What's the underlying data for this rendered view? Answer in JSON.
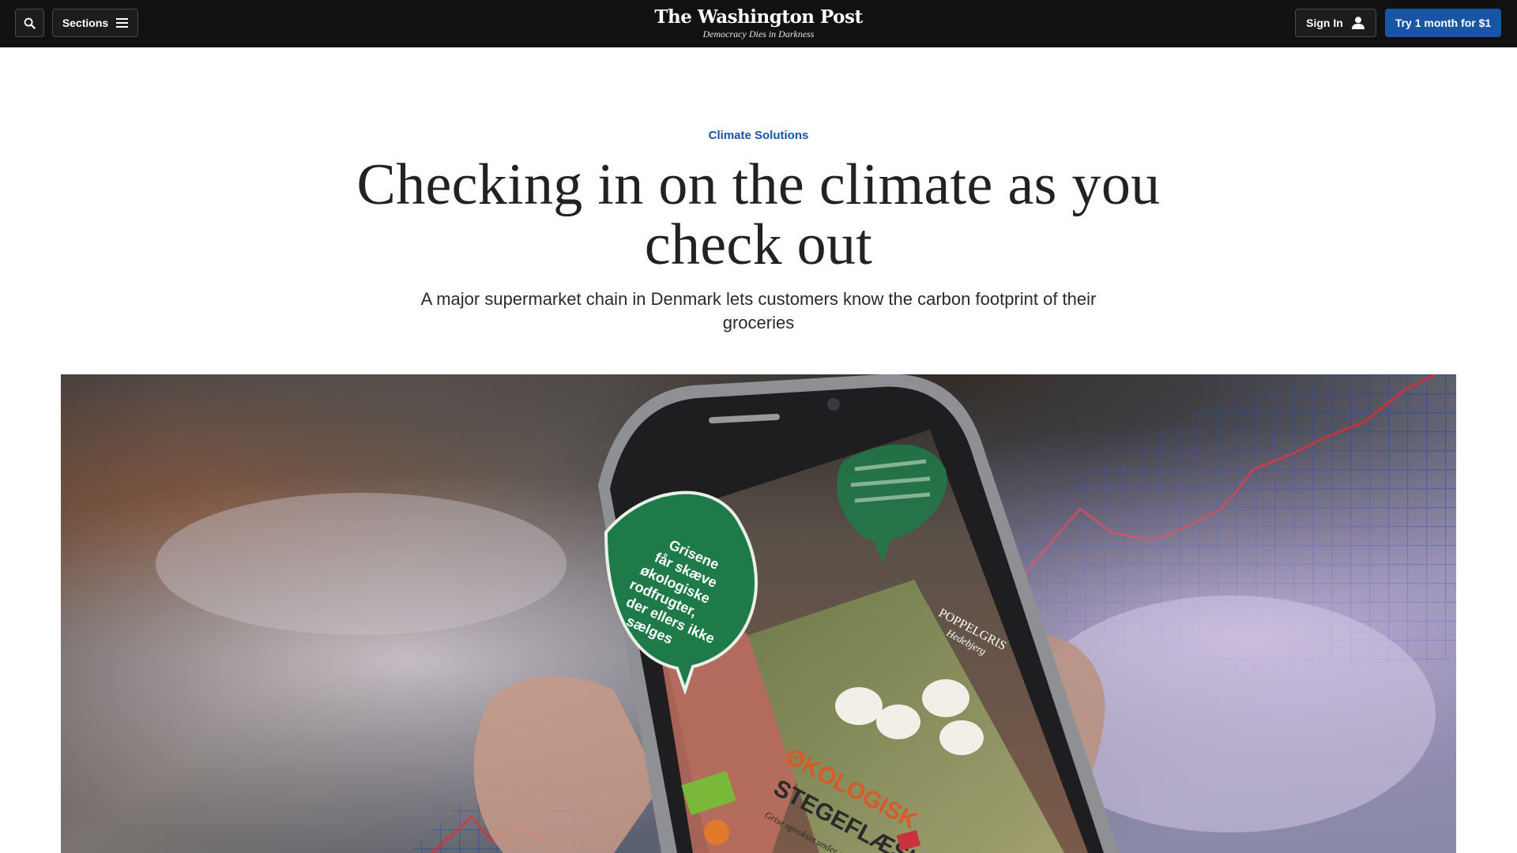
{
  "nav": {
    "search_icon": "search-icon",
    "sections_label": "Sections",
    "menu_icon": "hamburger-menu-icon",
    "signin_label": "Sign In",
    "user_icon": "user-icon",
    "subscribe_label": "Try 1 month for $1"
  },
  "masthead": {
    "logo": "The Washington Post",
    "tagline": "Democracy Dies in Darkness"
  },
  "article": {
    "kicker": "Climate Solutions",
    "headline": "Checking in on the climate as you check out",
    "dek": "A major supermarket chain in Denmark lets customers know the carbon footprint of their groceries"
  },
  "hero": {
    "leaf_label": "Grisene får skæve økologiske rodfrugter, der ellers ikke sælges",
    "brand": "POPPELGRIS",
    "brand_sub": "Hedebjerg",
    "product_line1": "ØKOLOGISK",
    "product_line2": "STEGEFLÆSK",
    "product_sub": "Grise opvokset under poppelgris",
    "colors": {
      "accent_blue": "#1955a5",
      "leaf_green": "#1f7a4a",
      "chart_red": "#c8323a"
    }
  }
}
